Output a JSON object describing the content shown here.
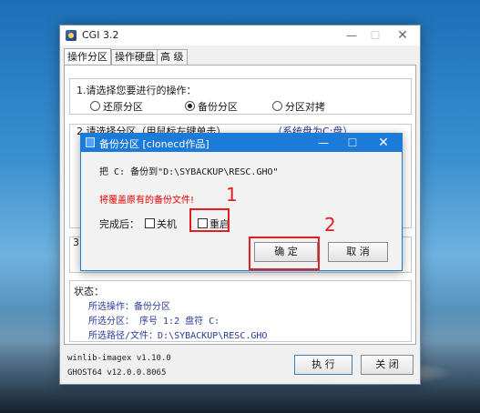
{
  "main_window": {
    "title": "CGI 3.2",
    "controls": {
      "minimize": "—",
      "maximize": "☐",
      "close": "✕"
    },
    "tabs": [
      {
        "label": "操作分区",
        "active": true
      },
      {
        "label": "操作硬盘",
        "active": false
      },
      {
        "label": "高 级",
        "active": false
      }
    ],
    "operation_group": {
      "prompt": "1.请选择您要进行的操作：",
      "options": [
        {
          "label": "还原分区",
          "selected": false
        },
        {
          "label": "备份分区",
          "selected": true
        },
        {
          "label": "分区对拷",
          "selected": false
        }
      ]
    },
    "partition_group": {
      "label": "2.请选择分区（用鼠标左键单击）",
      "hint": "（系统盘为C:盘）"
    },
    "path_group": {
      "label": "3."
    },
    "status": {
      "label": "状态：",
      "operation": "所选操作：备份分区",
      "partition": "所选分区：  序号 1:2       盘符 C:",
      "path": "所选路径/文件：D:\\SYBACKUP\\RESC.GHO"
    },
    "footer": {
      "line1": "winlib-imagex v1.10.0",
      "line2": "GHOST64 v12.0.0.8065"
    },
    "buttons": {
      "execute": "执 行",
      "close": "关 闭"
    }
  },
  "dialog": {
    "title": "备份分区 [clonecd作品]",
    "controls": {
      "minimize": "—",
      "maximize": "☐",
      "close": "✕"
    },
    "message": "把 C: 备份到\"D:\\SYBACKUP\\RESC.GHO\"",
    "warning": "将覆盖原有的备份文件!",
    "after_label": "完成后：",
    "options": [
      {
        "label": "关机",
        "checked": false
      },
      {
        "label": "重启",
        "checked": false
      }
    ],
    "buttons": {
      "ok": "确 定",
      "cancel": "取 消"
    }
  },
  "annotations": {
    "marker1": "1",
    "marker2": "2",
    "color": "#e41f1f"
  },
  "colors": {
    "dialog_title_bar": "#1c7ad9",
    "status_text": "#2a3a96",
    "warning_text": "#e60000"
  }
}
